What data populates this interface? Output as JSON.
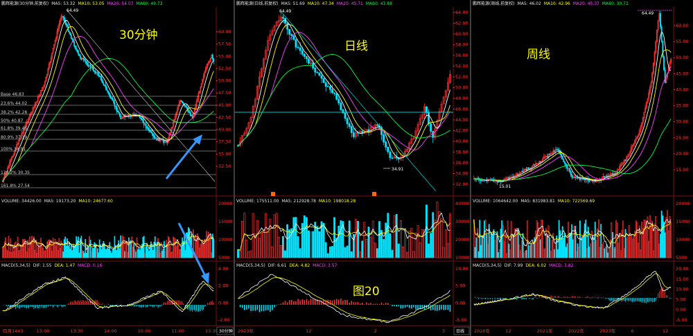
{
  "panels": [
    {
      "title": "鹏辉能源(30分钟,前复权)",
      "ma": {
        "ma5": "MA5: 53.32",
        "ma10": "MA10: 53.05",
        "ma20": "MA20: 54.07",
        "ma60": "MA60: 49.73"
      },
      "big_label": "30分钟",
      "peak_label": "64.49",
      "volume": {
        "label": "VOLUME: 34426.00",
        "ma5": "MA5: 19173.20",
        "ma10": "MA10: 24677.60"
      },
      "macd": {
        "label": "MACD(5,34,5)",
        "dif": "DIF: 1.55",
        "dea": "DEA: 1.47",
        "macd": "MACD: 0.16"
      },
      "fib": [
        "Base 46.83",
        "23.6% 44.02",
        "38.2% 42.28",
        "50% 40.87",
        "61.8% 39.46",
        "80.9% 37.19",
        "100% 34.91",
        "138.2% 30.35",
        "161.8% 27.54"
      ],
      "x_labels": [
        "四月1443",
        "13:00",
        "13:30",
        "14:00",
        "10:00",
        "11:00",
        "13:30"
      ],
      "y_ticks": [
        "60.00",
        "57.50",
        "55.00",
        "52.50",
        "50.00",
        "47.50",
        "45.00",
        "42.50",
        "40.00",
        "37.50",
        "35.00",
        "32.50"
      ],
      "vol_ticks": [
        "20000",
        "15000",
        "10000",
        "5000"
      ],
      "macd_ticks": [
        "4.00",
        "2.00",
        "0.00",
        "-2.00"
      ],
      "period_tab": "30分钟"
    },
    {
      "title": "鹏辉能源(日线,前复权)",
      "ma": {
        "ma5": "MA5: 51.69",
        "ma10": "MA10: 47.34",
        "ma20": "MA20: 45.71",
        "ma60": "MA60: 43.88"
      },
      "big_label": "日线",
      "peak_label": "64.49",
      "low_label": "34.91",
      "volume": {
        "label": "VOLUME: 175511.00",
        "ma5": "MA5: 212928.78",
        "ma10": "MA10: 198018.28"
      },
      "macd": {
        "label": "MACD(5,34,5)",
        "dif": "DIF: 6.61",
        "dea": "DEA: 4.82",
        "macd": "MACD: 3.57"
      },
      "fig_label": "图20",
      "x_labels": [
        "2023年",
        "12",
        "2",
        "3"
      ],
      "y_ticks": [
        "64.00",
        "62.00",
        "60.00",
        "58.00",
        "56.00",
        "54.00",
        "52.00",
        "50.00",
        "48.00",
        "46.00",
        "44.00",
        "42.00",
        "40.00",
        "38.00",
        "36.00",
        "34.00",
        "32.00"
      ],
      "vol_ticks": [
        "40000",
        "30000",
        "20000",
        "10000"
      ],
      "macd_ticks": [
        "10.00",
        "5.00",
        "0.00",
        "-5.00"
      ],
      "period_tab": "日线"
    },
    {
      "title": "鹏辉能源(周线,前复权)",
      "ma": {
        "ma5": "MA5: 46.02",
        "ma10": "MA10: 42.96",
        "ma20": "MA20: 45.37",
        "ma60": "MA60: 30.72"
      },
      "big_label": "周线",
      "peak_label": "64.49",
      "low_label": "15.01",
      "volume": {
        "label": "VOLUME: 1064642.00",
        "ma5": "MA5: 831983.81",
        "ma10": "MA10: 722569.69"
      },
      "macd": {
        "label": "MACD(5,34,5)",
        "dif": "DIF: 7.99",
        "dea": "DEA: 6.02",
        "macd": "MACD: 3.82"
      },
      "x_labels": [
        "2020年",
        "12",
        "2021年",
        "2022年",
        "2023年",
        "6",
        "12"
      ],
      "y_ticks": [
        "60.00",
        "55.00",
        "50.00",
        "45.00",
        "40.00",
        "35.00",
        "30.00",
        "25.00",
        "20.00",
        "15.00"
      ],
      "vol_ticks": [
        "20000",
        "15000",
        "10000",
        "5000"
      ],
      "macd_ticks": [
        "20.00",
        "15.00",
        "10.00",
        "5.00",
        "0.00",
        "-5.00"
      ],
      "period_tab": ""
    }
  ],
  "colors": {
    "up": "#ff3030",
    "down": "#00e5ff",
    "ma5": "#ffffff",
    "ma10": "#ffff00",
    "ma20": "#ff40ff",
    "ma60": "#00ff40",
    "annotation": "#3399ff"
  }
}
